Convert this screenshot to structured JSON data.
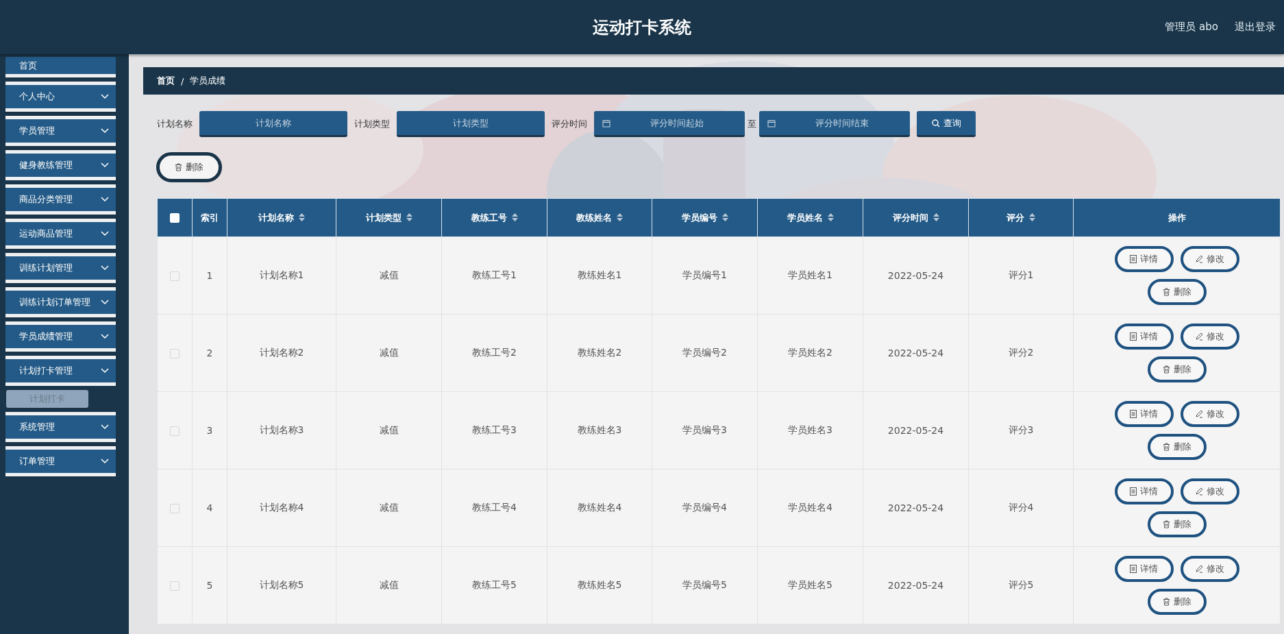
{
  "header": {
    "title": "运动打卡系统",
    "user": "管理员 abo",
    "logout": "退出登录"
  },
  "sidebar": {
    "items": [
      {
        "label": "首页",
        "kind": "link"
      },
      {
        "label": "个人中心",
        "kind": "menu"
      },
      {
        "label": "学员管理",
        "kind": "menu"
      },
      {
        "label": "健身教练管理",
        "kind": "menu"
      },
      {
        "label": "商品分类管理",
        "kind": "menu"
      },
      {
        "label": "运动商品管理",
        "kind": "menu"
      },
      {
        "label": "训练计划管理",
        "kind": "menu"
      },
      {
        "label": "训练计划订单管理",
        "kind": "menu"
      },
      {
        "label": "学员成绩管理",
        "kind": "menu"
      },
      {
        "label": "计划打卡管理",
        "kind": "menu",
        "children": [
          {
            "label": "计划打卡",
            "selected": true
          }
        ]
      },
      {
        "label": "系统管理",
        "kind": "menu"
      },
      {
        "label": "订单管理",
        "kind": "menu"
      }
    ]
  },
  "breadcrumb": {
    "items": [
      "首页",
      "学员成绩"
    ],
    "separator": "/"
  },
  "filters": [
    {
      "kind": "text",
      "label": "计划名称",
      "placeholder": "计划名称"
    },
    {
      "kind": "text",
      "label": "计划类型",
      "placeholder": "计划类型"
    },
    {
      "kind": "daterange",
      "label": "评分时间",
      "start_placeholder": "评分时间起始",
      "separator": "至",
      "end_placeholder": "评分时间结束"
    }
  ],
  "search_button": "查询",
  "delete_button": "删除",
  "table": {
    "select_all": {
      "checked": false
    },
    "columns": [
      {
        "label": "索引",
        "sortable": false
      },
      {
        "label": "计划名称",
        "sortable": true
      },
      {
        "label": "计划类型",
        "sortable": true
      },
      {
        "label": "教练工号",
        "sortable": true
      },
      {
        "label": "教练姓名",
        "sortable": true
      },
      {
        "label": "学员编号",
        "sortable": true
      },
      {
        "label": "学员姓名",
        "sortable": true
      },
      {
        "label": "评分时间",
        "sortable": true
      },
      {
        "label": "评分",
        "sortable": true
      },
      {
        "label": "操作",
        "sortable": false
      }
    ],
    "rows": [
      {
        "checked": false,
        "cells": [
          "1",
          "计划名称1",
          "减值",
          "教练工号1",
          "教练姓名1",
          "学员编号1",
          "学员姓名1",
          "2022-05-24",
          "评分1"
        ],
        "actions": [
          {
            "kind": "detail",
            "label": "详情"
          },
          {
            "kind": "edit",
            "label": "修改"
          },
          {
            "kind": "delete",
            "label": "删除"
          }
        ]
      },
      {
        "checked": false,
        "cells": [
          "2",
          "计划名称2",
          "减值",
          "教练工号2",
          "教练姓名2",
          "学员编号2",
          "学员姓名2",
          "2022-05-24",
          "评分2"
        ],
        "actions": [
          {
            "kind": "detail",
            "label": "详情"
          },
          {
            "kind": "edit",
            "label": "修改"
          },
          {
            "kind": "delete",
            "label": "删除"
          }
        ]
      },
      {
        "checked": false,
        "cells": [
          "3",
          "计划名称3",
          "减值",
          "教练工号3",
          "教练姓名3",
          "学员编号3",
          "学员姓名3",
          "2022-05-24",
          "评分3"
        ],
        "actions": [
          {
            "kind": "detail",
            "label": "详情"
          },
          {
            "kind": "edit",
            "label": "修改"
          },
          {
            "kind": "delete",
            "label": "删除"
          }
        ]
      },
      {
        "checked": false,
        "cells": [
          "4",
          "计划名称4",
          "减值",
          "教练工号4",
          "教练姓名4",
          "学员编号4",
          "学员姓名4",
          "2022-05-24",
          "评分4"
        ],
        "actions": [
          {
            "kind": "detail",
            "label": "详情"
          },
          {
            "kind": "edit",
            "label": "修改"
          },
          {
            "kind": "delete",
            "label": "删除"
          }
        ]
      },
      {
        "checked": false,
        "cells": [
          "5",
          "计划名称5",
          "减值",
          "教练工号5",
          "教练姓名5",
          "学员编号5",
          "学员姓名5",
          "2022-05-24",
          "评分5"
        ],
        "actions": [
          {
            "kind": "detail",
            "label": "详情"
          },
          {
            "kind": "edit",
            "label": "修改"
          },
          {
            "kind": "delete",
            "label": "删除"
          }
        ]
      }
    ]
  }
}
